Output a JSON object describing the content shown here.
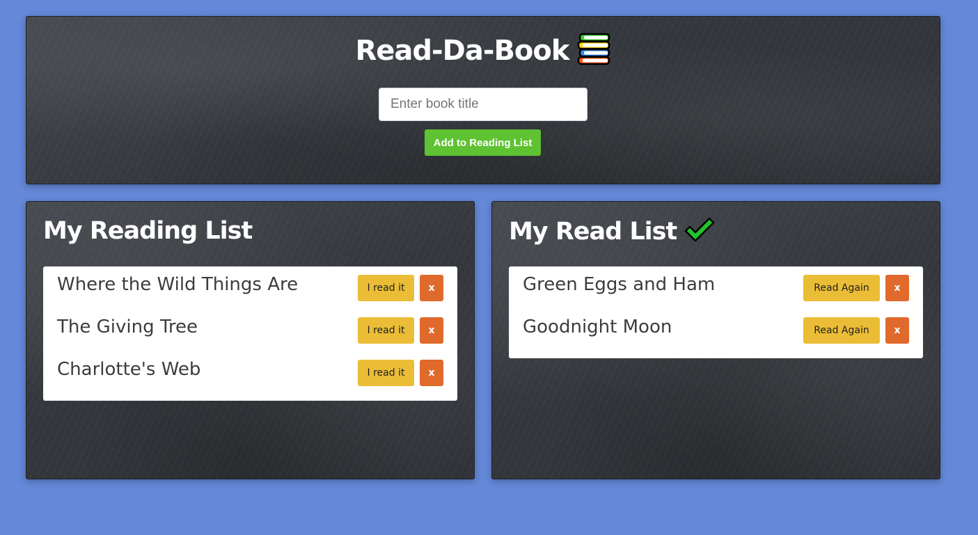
{
  "app": {
    "title": "Read-Da-Book",
    "title_icon": "books-stack-icon"
  },
  "add_form": {
    "input_placeholder": "Enter book title",
    "input_value": "",
    "add_button_label": "Add to Reading List"
  },
  "reading_list": {
    "heading": "My Reading List",
    "books": [
      {
        "title": "Where the Wild Things Are",
        "action_label": "I read it",
        "remove_label": "x"
      },
      {
        "title": "The Giving Tree",
        "action_label": "I read it",
        "remove_label": "x"
      },
      {
        "title": "Charlotte's Web",
        "action_label": "I read it",
        "remove_label": "x"
      }
    ]
  },
  "read_list": {
    "heading": "My Read List",
    "heading_icon": "checkmark-icon",
    "books": [
      {
        "title": "Green Eggs and Ham",
        "action_label": "Read Again",
        "remove_label": "x"
      },
      {
        "title": "Goodnight Moon",
        "action_label": "Read Again",
        "remove_label": "x"
      }
    ]
  },
  "colors": {
    "page_background": "#6589d8",
    "add_button": "#5ec232",
    "status_button": "#ebbd36",
    "remove_button": "#e0692c",
    "checkmark": "#22c22b"
  }
}
